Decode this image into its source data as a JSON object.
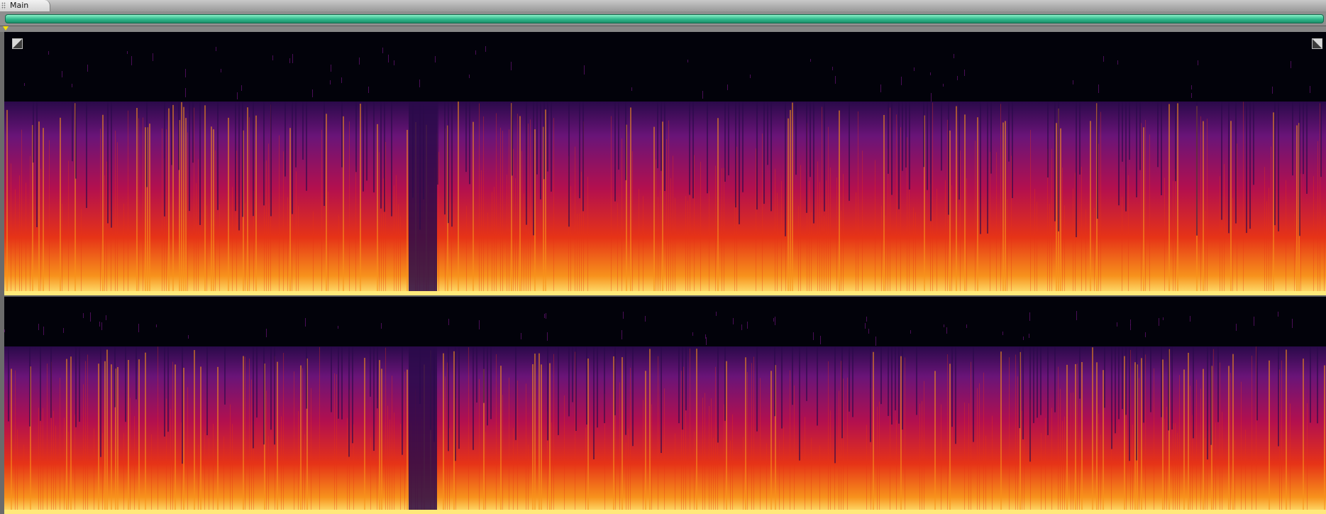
{
  "window": {
    "tab_label": "Main"
  },
  "overview": {
    "range_color": "#3cd6a0"
  },
  "playhead": {
    "color": "#f6e20a"
  },
  "spectrogram": {
    "channels": [
      "upper",
      "lower"
    ],
    "colormap": [
      "#000008",
      "#2a0a4a",
      "#6a1478",
      "#b3104e",
      "#e63317",
      "#f7921c",
      "#ffe97a"
    ],
    "icons": {
      "zoom_left": "zoom-toggle-icon",
      "zoom_right": "zoom-toggle-icon"
    }
  }
}
